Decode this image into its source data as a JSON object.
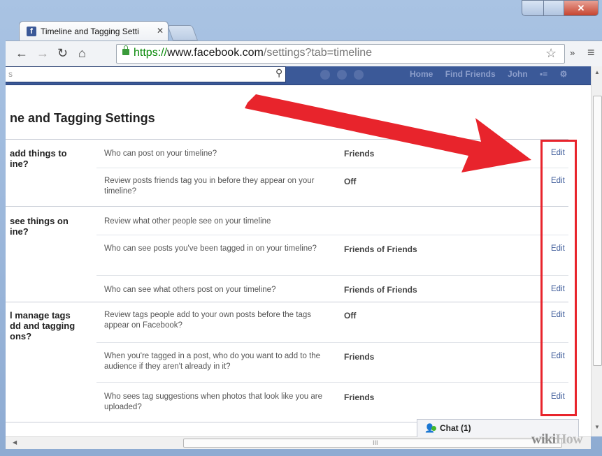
{
  "browser": {
    "tab_title": "Timeline and Tagging Setti",
    "tab_favicon": "f",
    "url_scheme": "https://",
    "url_host": "www.facebook.com",
    "url_path": "/settings?tab=timeline"
  },
  "fb_header": {
    "search_placeholder": "s",
    "links": [
      "Home",
      "Find Friends",
      "John"
    ]
  },
  "page": {
    "title": "ne and Tagging Settings"
  },
  "sections": [
    {
      "label": "add things to\nine?",
      "rows": [
        {
          "question": "Who can post on your timeline?",
          "value": "Friends",
          "edit": "Edit"
        },
        {
          "question": "Review posts friends tag you in before they appear on your timeline?",
          "value": "Off",
          "edit": "Edit"
        }
      ]
    },
    {
      "label": "see things on\nine?",
      "rows": [
        {
          "question": "Review what other people see on your timeline",
          "value": "",
          "edit": ""
        },
        {
          "question": "Who can see posts you've been tagged in on your timeline?",
          "value": "Friends of Friends",
          "edit": "Edit"
        },
        {
          "question": "Who can see what others post on your timeline?",
          "value": "Friends of Friends",
          "edit": "Edit"
        }
      ]
    },
    {
      "label": "l manage tags\ndd and tagging\nons?",
      "rows": [
        {
          "question": "Review tags people add to your own posts before the tags appear on Facebook?",
          "value": "Off",
          "edit": "Edit"
        },
        {
          "question": "When you're tagged in a post, who do you want to add to the audience if they aren't already in it?",
          "value": "Friends",
          "edit": "Edit"
        },
        {
          "question": "Who sees tag suggestions when photos that look like you are uploaded?",
          "value": "Friends",
          "edit": "Edit"
        }
      ]
    }
  ],
  "chat": {
    "label": "Chat (1)"
  },
  "watermark": {
    "part1": "wiki",
    "part2": "How"
  },
  "colors": {
    "fb_blue": "#3b5998",
    "annotation_red": "#e8242c",
    "link": "#3b5998"
  }
}
